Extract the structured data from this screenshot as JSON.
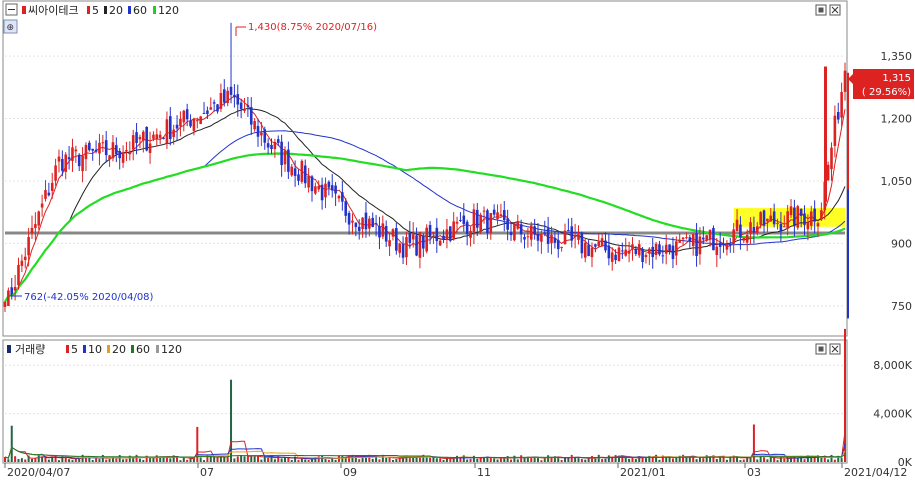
{
  "chart_data": [
    {
      "type": "candlestick",
      "title": "씨아이테크",
      "legend": [
        {
          "label": "5",
          "color": "#dd2222"
        },
        {
          "label": "20",
          "color": "#222222"
        },
        {
          "label": "60",
          "color": "#2233cc"
        },
        {
          "label": "120",
          "color": "#22cc22"
        }
      ],
      "y_ticks": [
        "1,350",
        "1,200",
        "1,050",
        "900",
        "750"
      ],
      "y_tick_values": [
        1350,
        1200,
        1050,
        900,
        750
      ],
      "ylim": [
        680,
        1480
      ],
      "price_badge": {
        "price": "1,315",
        "change": "( 29.56%)"
      },
      "max_annotation": "1,430(8.75% 2020/07/16)",
      "min_annotation": "762(-42.05% 2020/04/08)",
      "max_value": 1430,
      "min_value": 762,
      "last_close": 1315,
      "reference_line": 925,
      "highlight_range": [
        940,
        985
      ],
      "key_closes": [
        {
          "date": "2020/04/07",
          "close": 790
        },
        {
          "date": "2020/04/08",
          "close": 762
        },
        {
          "date": "2020/05/01",
          "close": 1100
        },
        {
          "date": "2020/06/01",
          "close": 1130
        },
        {
          "date": "2020/07/16",
          "close": 1250
        },
        {
          "date": "2020/08/01",
          "close": 1140
        },
        {
          "date": "2020/09/01",
          "close": 990
        },
        {
          "date": "2020/10/01",
          "close": 890
        },
        {
          "date": "2020/11/01",
          "close": 960
        },
        {
          "date": "2020/12/01",
          "close": 910
        },
        {
          "date": "2021/01/01",
          "close": 880
        },
        {
          "date": "2021/02/01",
          "close": 890
        },
        {
          "date": "2021/03/01",
          "close": 940
        },
        {
          "date": "2021/04/01",
          "close": 975
        },
        {
          "date": "2021/04/12",
          "close": 1315
        }
      ]
    },
    {
      "type": "bar",
      "title": "거래량",
      "legend": [
        {
          "label": "5",
          "color": "#dd2222"
        },
        {
          "label": "10",
          "color": "#2233cc"
        },
        {
          "label": "20",
          "color": "#e0a020"
        },
        {
          "label": "60",
          "color": "#227722"
        },
        {
          "label": "120",
          "color": "#999999"
        }
      ],
      "y_ticks": [
        "8,000K",
        "4,000K",
        "0K"
      ],
      "y_tick_values": [
        8000,
        4000,
        0
      ],
      "ylim": [
        0,
        10000
      ],
      "unit": "K",
      "spikes": [
        {
          "date": "2020/04/10",
          "value": 3000
        },
        {
          "date": "2020/07/16",
          "value": 6800
        },
        {
          "date": "2020/07/01",
          "value": 2900
        },
        {
          "date": "2021/03/03",
          "value": 3100
        },
        {
          "date": "2021/04/12",
          "value": 11000
        }
      ]
    }
  ],
  "x_axis": {
    "labels": [
      "2020/04/07",
      "07",
      "09",
      "11",
      "2021/01",
      "03",
      "2021/04/12"
    ]
  },
  "colors": {
    "up": "#dd2222",
    "down": "#2233cc",
    "highlight": "#ffff00",
    "ma120": "#22dd22"
  }
}
